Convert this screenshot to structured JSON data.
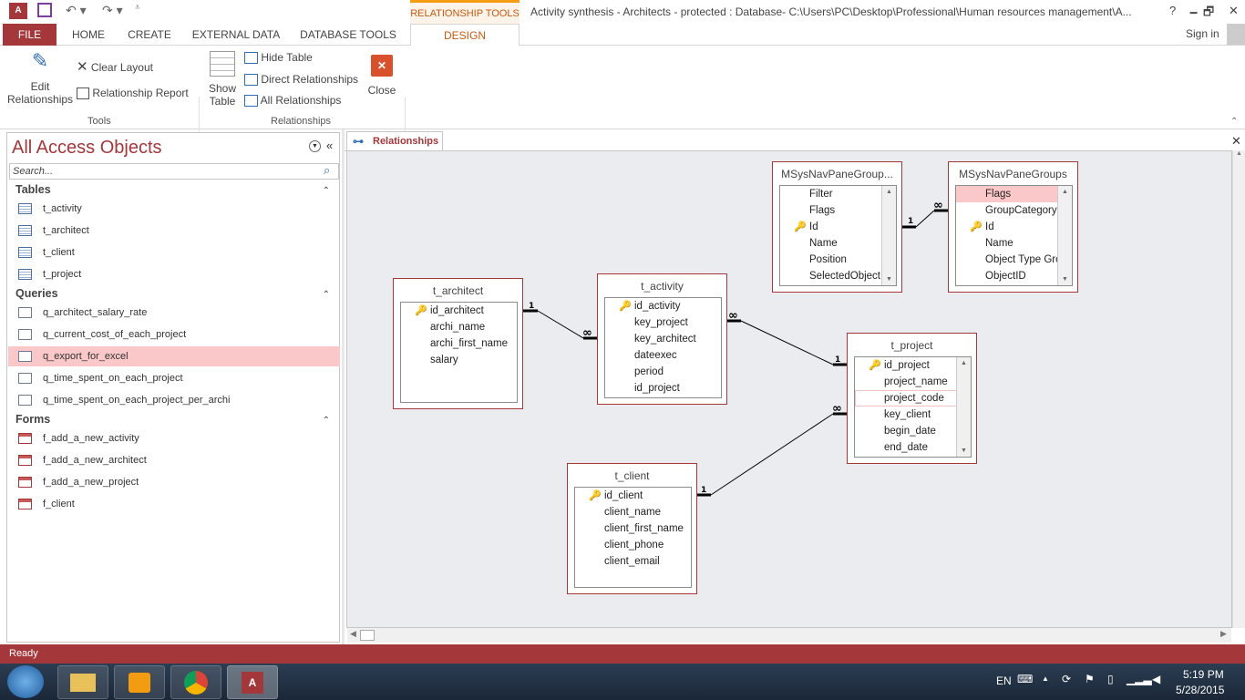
{
  "titlebar": {
    "title": "Activity synthesis - Architects - protected : Database- C:\\Users\\PC\\Desktop\\Professional\\Human resources management\\A...",
    "context_tab": "RELATIONSHIP TOOLS",
    "help": "?",
    "minimize": "🗕",
    "restore": "🗗",
    "close": "✕",
    "signin": "Sign in"
  },
  "tabs": [
    "FILE",
    "HOME",
    "CREATE",
    "EXTERNAL DATA",
    "DATABASE TOOLS",
    "DESIGN"
  ],
  "ribbon": {
    "edit_rel_1": "Edit",
    "edit_rel_2": "Relationships",
    "clear_layout": "Clear Layout",
    "rel_report": "Relationship Report",
    "group_tools": "Tools",
    "show_table_1": "Show",
    "show_table_2": "Table",
    "hide_table": "Hide Table",
    "direct_rel": "Direct Relationships",
    "all_rel": "All Relationships",
    "close": "Close",
    "group_relationships": "Relationships"
  },
  "nav": {
    "title": "All Access Objects",
    "search_placeholder": "Search...",
    "sections": [
      {
        "label": "Tables",
        "items": [
          "t_activity",
          "t_architect",
          "t_client",
          "t_project"
        ]
      },
      {
        "label": "Queries",
        "items": [
          "q_architect_salary_rate",
          "q_current_cost_of_each_project",
          "q_export_for_excel",
          "q_time_spent_on_each_project",
          "q_time_spent_on_each_project_per_archi"
        ]
      },
      {
        "label": "Forms",
        "items": [
          "f_add_a_new_activity",
          "f_add_a_new_architect",
          "f_add_a_new_project",
          "f_client"
        ]
      }
    ],
    "selected": "q_export_for_excel"
  },
  "document_tab": "Relationships",
  "tables": [
    {
      "name": "MSysNavPaneGroup...",
      "fields": [
        {
          "n": "Filter"
        },
        {
          "n": "Flags"
        },
        {
          "n": "Id",
          "key": true
        },
        {
          "n": "Name"
        },
        {
          "n": "Position"
        },
        {
          "n": "SelectedObjectI"
        }
      ],
      "scroll": true
    },
    {
      "name": "MSysNavPaneGroups",
      "fields": [
        {
          "n": "Flags",
          "hl": true
        },
        {
          "n": "GroupCategory"
        },
        {
          "n": "Id",
          "key": true
        },
        {
          "n": "Name"
        },
        {
          "n": "Object Type Gro"
        },
        {
          "n": "ObjectID"
        }
      ],
      "scroll": true
    },
    {
      "name": "t_architect",
      "fields": [
        {
          "n": "id_architect",
          "key": true
        },
        {
          "n": "archi_name"
        },
        {
          "n": "archi_first_name"
        },
        {
          "n": "salary"
        }
      ]
    },
    {
      "name": "t_activity",
      "fields": [
        {
          "n": "id_activity",
          "key": true
        },
        {
          "n": "key_project"
        },
        {
          "n": "key_architect"
        },
        {
          "n": "dateexec"
        },
        {
          "n": "period"
        },
        {
          "n": "id_project"
        }
      ]
    },
    {
      "name": "t_project",
      "fields": [
        {
          "n": "id_project",
          "key": true
        },
        {
          "n": "project_name"
        },
        {
          "n": "project_code",
          "outline": true
        },
        {
          "n": "key_client"
        },
        {
          "n": "begin_date"
        },
        {
          "n": "end_date"
        }
      ],
      "scroll": true
    },
    {
      "name": "t_client",
      "fields": [
        {
          "n": "id_client",
          "key": true
        },
        {
          "n": "client_name"
        },
        {
          "n": "client_first_name"
        },
        {
          "n": "client_phone"
        },
        {
          "n": "client_email"
        }
      ]
    }
  ],
  "relationships": [
    {
      "from": "MSysNavPaneGroup...",
      "to": "MSysNavPaneGroups",
      "one": "1",
      "many": "∞"
    },
    {
      "from": "t_architect",
      "to": "t_activity",
      "one": "1",
      "many": "∞"
    },
    {
      "from": "t_project",
      "to": "t_activity",
      "one": "1",
      "many": "∞"
    },
    {
      "from": "t_client",
      "to": "t_project",
      "one": "1",
      "many": "∞"
    }
  ],
  "status": "Ready",
  "tray": {
    "lang": "EN",
    "time": "5:19 PM",
    "date": "5/28/2015"
  },
  "colors": {
    "accent": "#a4373a",
    "context": "#c65a11",
    "selection": "#fbc8c9"
  }
}
